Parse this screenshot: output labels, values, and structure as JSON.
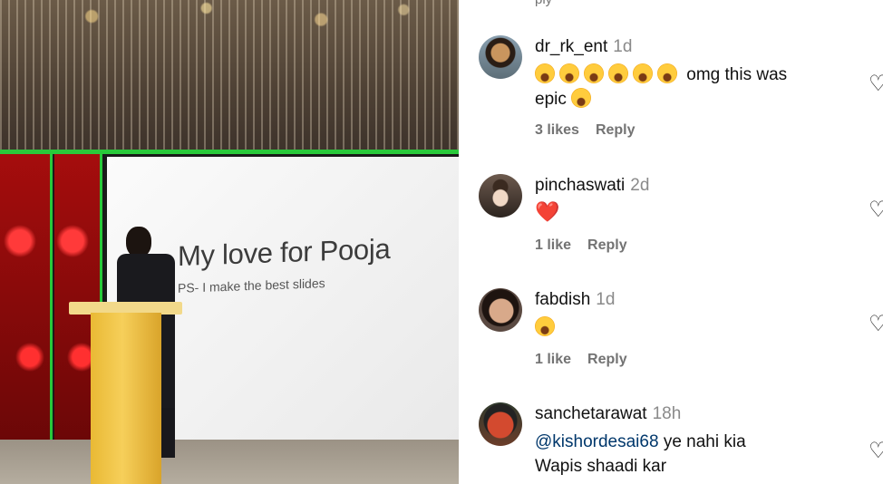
{
  "video": {
    "slide_title": "My love for Pooja",
    "slide_subtitle": "PS- I make the best slides"
  },
  "comments_panel": {
    "top_partial_text": "ply",
    "comments": [
      {
        "username": "dr_rk_ent",
        "time": "1d",
        "emoji_count_line1": 6,
        "text_part1": "omg this was",
        "text_part2": "epic",
        "likes": "3 likes",
        "reply": "Reply"
      },
      {
        "username": "pinchaswati",
        "time": "2d",
        "emoji": "❤️",
        "likes": "1 like",
        "reply": "Reply"
      },
      {
        "username": "fabdish",
        "time": "1d",
        "emoji": "😂",
        "likes": "1 like",
        "reply": "Reply"
      },
      {
        "username": "sanchetarawat",
        "time": "18h",
        "mention": "@kishordesai68",
        "text_part1": "ye nahi kia",
        "text_part2": "Wapis shaadi kar"
      }
    ],
    "like_icon": "heart-outline-icon"
  }
}
